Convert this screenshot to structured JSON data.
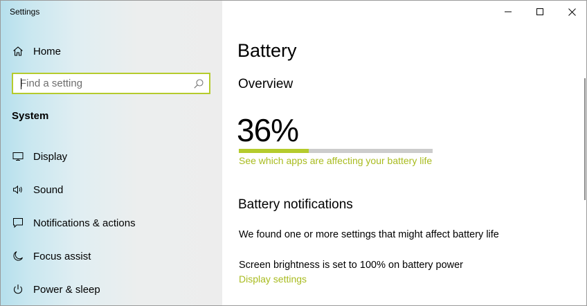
{
  "window": {
    "title": "Settings"
  },
  "sidebar": {
    "home_label": "Home",
    "search": {
      "placeholder": "Find a setting",
      "value": ""
    },
    "section_label": "System",
    "items": [
      {
        "label": "Display",
        "icon": "monitor-icon"
      },
      {
        "label": "Sound",
        "icon": "speaker-icon"
      },
      {
        "label": "Notifications & actions",
        "icon": "message-icon"
      },
      {
        "label": "Focus assist",
        "icon": "moon-icon"
      },
      {
        "label": "Power & sleep",
        "icon": "power-icon"
      }
    ]
  },
  "main": {
    "page_title": "Battery",
    "overview": {
      "heading": "Overview",
      "percent_text": "36%",
      "percent_value": 36,
      "apps_link": "See which apps are affecting your battery life"
    },
    "notifications": {
      "heading": "Battery notifications",
      "found_text": "We found one or more settings that might affect battery life",
      "brightness_text": "Screen brightness is set to 100% on battery power",
      "display_link": "Display settings"
    }
  },
  "colors": {
    "accent": "#b5cb2c",
    "link": "#a8bb1e",
    "track": "#cccccc"
  }
}
